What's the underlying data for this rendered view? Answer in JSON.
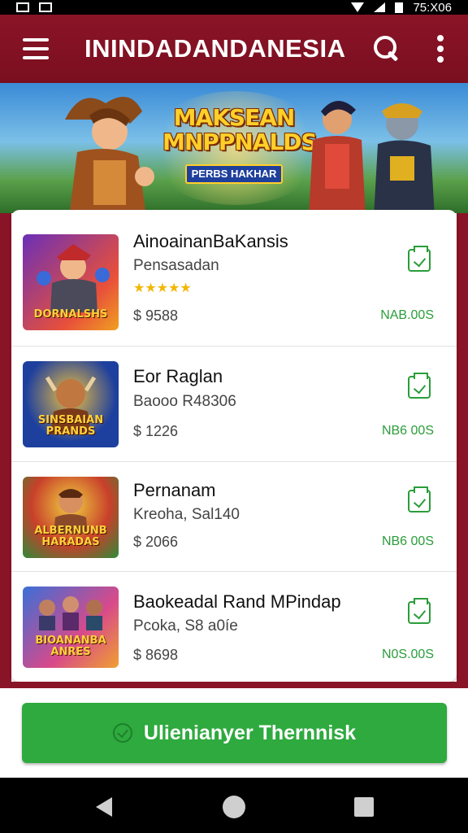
{
  "status_bar": {
    "time": "75:X06"
  },
  "app_bar": {
    "title": "ININDADANDANESIA"
  },
  "banner": {
    "title": "MAKSEAN MNPPNALDS",
    "subtitle": "PERBS HAKHAR"
  },
  "items": [
    {
      "title": "AinoainanBaKansis",
      "subtitle": "Pensasadan",
      "stars": "★★★★★",
      "price": "$ 9588",
      "status": "NAB.00S",
      "thumb_caption": "DORNALSHS",
      "thumb_colors": [
        "#6a2fb8",
        "#e8503a"
      ]
    },
    {
      "title": "Eor Raglan",
      "subtitle": "Baooo R48306",
      "stars": "",
      "price": "$ 1226",
      "status": "NB6 00S",
      "thumb_caption": "SINSBAIAN PRANDS",
      "thumb_colors": [
        "#1d3f9e",
        "#f0a020"
      ]
    },
    {
      "title": "Pernanam",
      "subtitle": "Kreoha, Sal140",
      "stars": "",
      "price": "$ 2066",
      "status": "NB6 00S",
      "thumb_caption": "ALBERNUNB HARADAS",
      "thumb_colors": [
        "#c8402a",
        "#2f8a3a"
      ]
    },
    {
      "title": "Baokeadal Rand MPindap",
      "subtitle": "Pcoka, S8 a0íe",
      "stars": "",
      "price": "$ 8698",
      "status": "N0S.00S",
      "thumb_caption": "BIOANANBA ANRES",
      "thumb_colors": [
        "#3a6fd8",
        "#d84a8a"
      ]
    }
  ],
  "primary_button": {
    "label": "Ulienianyer Thernnisk"
  },
  "colors": {
    "brand": "#8a1427",
    "accent": "#2eaa3e",
    "star": "#f2b705"
  }
}
